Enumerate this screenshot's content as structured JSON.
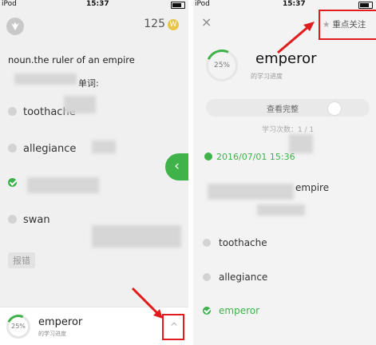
{
  "left": {
    "status": {
      "carrier": "iPod",
      "time": "15:37"
    },
    "coins": {
      "count": "125",
      "icon": "W"
    },
    "definition": "noun.the ruler of an empire",
    "prompt_suffix": "单词:",
    "options": [
      "toothache",
      "allegiance",
      "swan"
    ],
    "report_label": "报错",
    "next_arrow": "‹",
    "bottom": {
      "progress": "25%",
      "progress_value": 0.25,
      "word": "emperor",
      "subtitle": "的学习进度"
    },
    "expand_chevron": "^"
  },
  "right": {
    "status": {
      "carrier": "iPod",
      "time": "15:37"
    },
    "close_icon": "×",
    "follow_label": "重点关注",
    "progress": "25%",
    "progress_value": 0.25,
    "word": "emperor",
    "progress_label": "的学习进度",
    "pill_label": "查看完整",
    "study_times": "学习次数：1 / 1",
    "date": "2016/07/01 15:36",
    "empire_text": "empire",
    "options": [
      "toothache",
      "allegiance",
      "emperor"
    ]
  },
  "colors": {
    "accent_green": "#3fb34a",
    "annotation_red": "#e21c1c"
  }
}
